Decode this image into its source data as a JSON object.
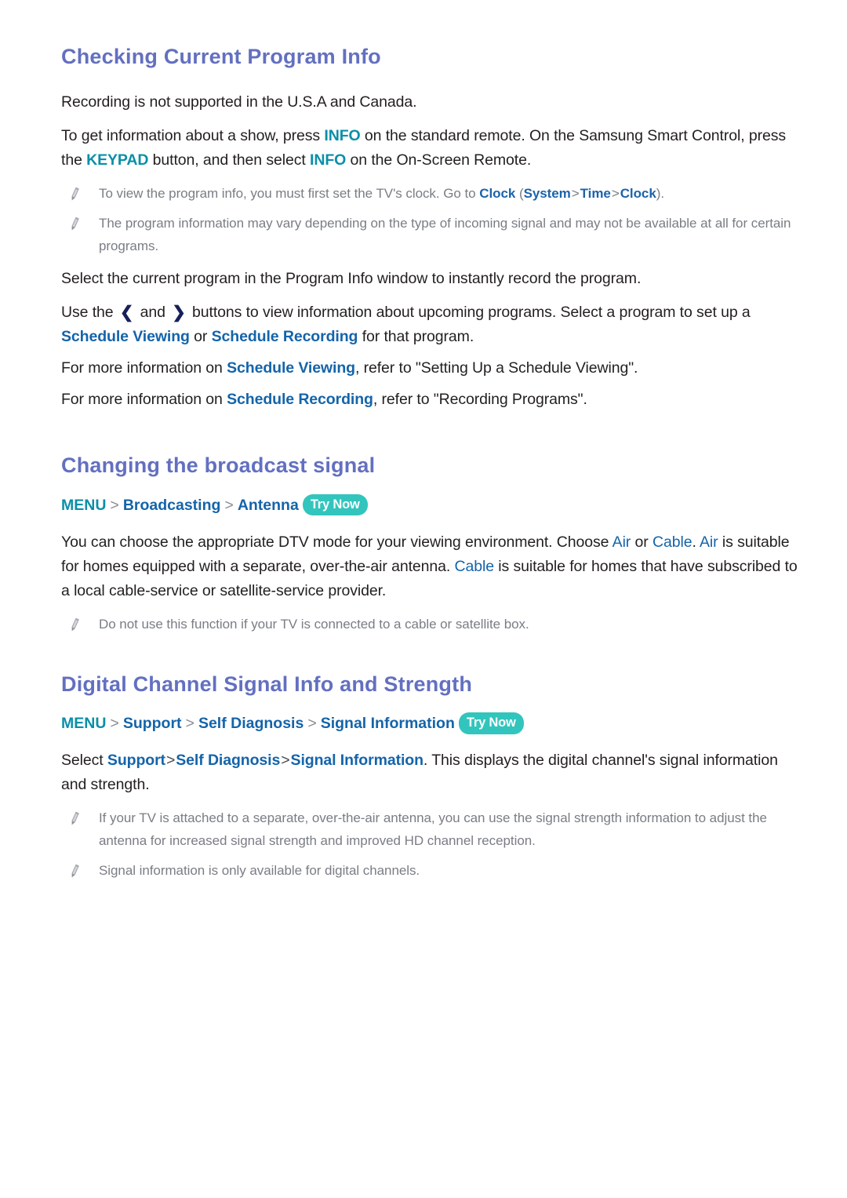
{
  "document": {
    "theme": {
      "heading_color": "#6370c0",
      "accent_blue": "#1464aa",
      "accent_teal": "#0a8fa8",
      "badge_teal": "#32c5bd",
      "body_color": "#231f20",
      "note_color": "#7a7d85"
    }
  },
  "sections": [
    {
      "id": "checking-current-program-info",
      "title": "Checking Current Program Info",
      "paragraph_1": "Recording is not supported in the U.S.A and Canada.",
      "paragraph_2": {
        "part_1": "To get information about a show, press ",
        "kw_info_1": "INFO",
        "part_2": " on the standard remote. On the Samsung Smart Control, press the ",
        "kw_keypad": "KEYPAD",
        "part_3": " button, and then select ",
        "kw_info_2": "INFO",
        "part_4": " on the On-Screen Remote."
      },
      "note_1": {
        "part_1": "To view the program info, you must first set the TV's clock. Go to ",
        "kw_clock_1": "Clock",
        "part_2": " (",
        "kw_system": "System",
        "sep_1": ">",
        "kw_time": "Time",
        "sep_2": ">",
        "kw_clock_2": "Clock",
        "part_3": ")."
      },
      "note_2": "The program information may vary depending on the type of incoming signal and may not be available at all for certain programs.",
      "paragraph_3": "Select the current program in the Program Info window to instantly record the program.",
      "paragraph_4": {
        "part_1": "Use the ",
        "arrow_left": "❮",
        "part_2": " and ",
        "arrow_right": "❯",
        "part_3": " buttons to view information about upcoming programs. Select a program to set up a ",
        "kw_schedule_viewing": "Schedule Viewing",
        "part_4": " or ",
        "kw_schedule_recording": "Schedule Recording",
        "part_5": " for that program."
      },
      "paragraph_5": {
        "part_1": "For more information on ",
        "kw": "Schedule Viewing",
        "part_2": ", refer to \"Setting Up a Schedule Viewing\"."
      },
      "paragraph_6": {
        "part_1": "For more information on ",
        "kw": "Schedule Recording",
        "part_2": ", refer to \"Recording Programs\"."
      }
    },
    {
      "id": "changing-the-broadcast-signal",
      "title": "Changing the broadcast signal",
      "menu_path": {
        "root": "MENU",
        "sep": ">",
        "items": [
          "Broadcasting",
          "Antenna"
        ],
        "badge": "Try Now"
      },
      "paragraph_1": {
        "part_1": "You can choose the appropriate DTV mode for your viewing environment. Choose ",
        "kw_air_1": "Air",
        "part_2": " or ",
        "kw_cable_1": "Cable",
        "part_3": ". ",
        "kw_air_2": "Air",
        "part_4": " is suitable for homes equipped with a separate, over-the-air antenna. ",
        "kw_cable_2": "Cable",
        "part_5": " is suitable for homes that have subscribed to a local cable-service or satellite-service provider."
      },
      "note_1": "Do not use this function if your TV is connected to a cable or satellite box."
    },
    {
      "id": "digital-channel-signal-info-and-strength",
      "title": "Digital Channel Signal Info and Strength",
      "menu_path": {
        "root": "MENU",
        "sep": ">",
        "items": [
          "Support",
          "Self Diagnosis",
          "Signal Information"
        ],
        "badge": "Try Now"
      },
      "paragraph_1": {
        "part_1": "Select ",
        "kw_1": "Support",
        "sep_1": ">",
        "kw_2": "Self Diagnosis",
        "sep_2": ">",
        "kw_3": "Signal Information",
        "part_2": ". This displays the digital channel's signal information and strength."
      },
      "note_1": "If your TV is attached to a separate, over-the-air antenna, you can use the signal strength information to adjust the antenna for increased signal strength and improved HD channel reception.",
      "note_2": "Signal information is only available for digital channels."
    }
  ]
}
